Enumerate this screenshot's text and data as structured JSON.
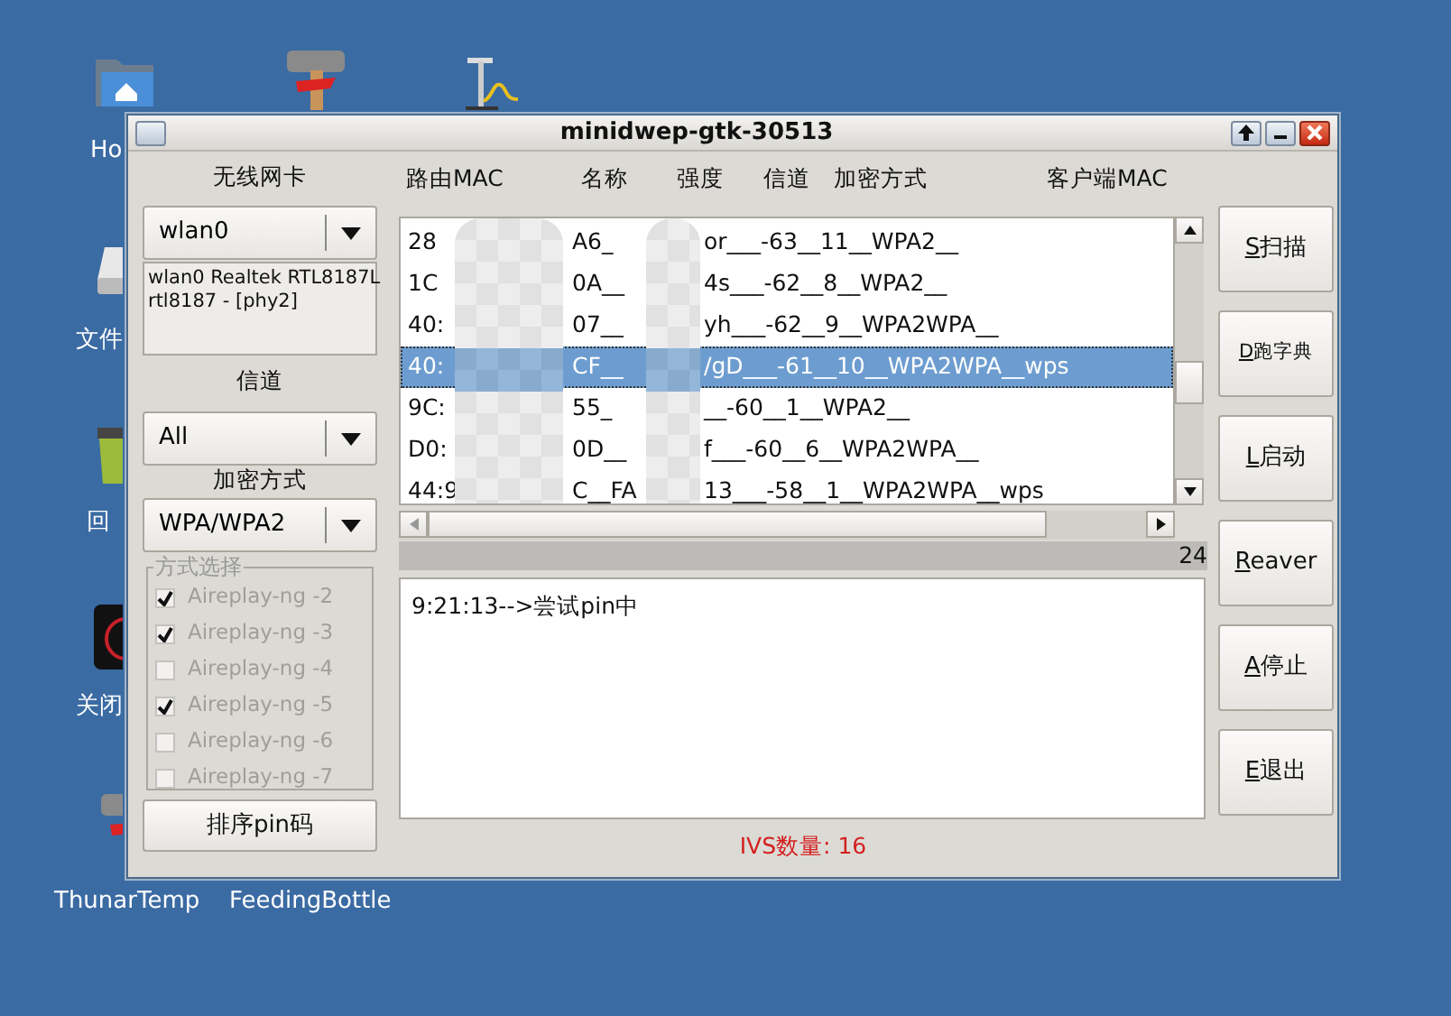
{
  "desktop": {
    "icons": [
      {
        "kind": "home",
        "label": "Ho"
      },
      {
        "kind": "tool"
      },
      {
        "kind": "pump"
      },
      {
        "kind": "drive",
        "label": "文件"
      },
      {
        "kind": "trash",
        "label": "回"
      },
      {
        "kind": "power",
        "label": "关闭"
      },
      {
        "kind": "tool",
        "label": "ThunarTemp"
      },
      {
        "kind": "hidden",
        "label": "FeedingBottle"
      }
    ]
  },
  "window": {
    "title": "minidwep-gtk-30513",
    "interface": {
      "label": "无线网卡",
      "value": "wlan0",
      "info": "wlan0 Realtek RTL8187L\nrtl8187 - [phy2]"
    },
    "channel": {
      "label": "信道",
      "value": "All"
    },
    "encryption": {
      "label": "加密方式",
      "value": "WPA/WPA2"
    },
    "methods": {
      "title": "方式选择",
      "items": [
        {
          "label": "Aireplay-ng -2",
          "checked": true,
          "disabled": true
        },
        {
          "label": "Aireplay-ng -3",
          "checked": true,
          "disabled": true
        },
        {
          "label": "Aireplay-ng -4",
          "checked": false,
          "disabled": true
        },
        {
          "label": "Aireplay-ng -5",
          "checked": true,
          "disabled": true
        },
        {
          "label": "Aireplay-ng -6",
          "checked": false,
          "disabled": true
        },
        {
          "label": "Aireplay-ng -7",
          "checked": false,
          "disabled": true
        }
      ]
    },
    "sort_button": "排序pin码",
    "networks": {
      "columns": [
        "路由MAC",
        "名称",
        "强度",
        "信道",
        "加密方式",
        "客户端MAC"
      ],
      "rows": [
        {
          "parts": [
            "28",
            "A6_",
            "or___-63__11__WPA2__"
          ],
          "selected": false
        },
        {
          "parts": [
            "1C",
            "0A__",
            "4s___-62__8__WPA2__"
          ],
          "selected": false
        },
        {
          "parts": [
            "40:",
            "07__",
            "yh___-62__9__WPA2WPA__"
          ],
          "selected": false
        },
        {
          "parts": [
            "40:",
            "CF__",
            "/gD___-61__10__WPA2WPA__wps"
          ],
          "selected": true
        },
        {
          "parts": [
            "9C:",
            "55_",
            "__-60__1__WPA2__"
          ],
          "selected": false
        },
        {
          "parts": [
            "D0:",
            "0D__",
            "f___-60__6__WPA2WPA__"
          ],
          "selected": false
        },
        {
          "parts": [
            "44:9",
            "C__FA",
            "13___-58__1__WPA2WPA__wps"
          ],
          "selected": false
        }
      ]
    },
    "count": "24",
    "log": [
      "9:21:13-->尝试pin中"
    ],
    "status": "IVS数量: 16",
    "buttons": [
      {
        "label": "S扫描",
        "kind": "normal"
      },
      {
        "label": "D跑字典",
        "kind": "small"
      },
      {
        "label": "L启动",
        "kind": "normal"
      },
      {
        "label": "Reaver",
        "kind": "normal"
      },
      {
        "label": "A停止",
        "kind": "normal"
      },
      {
        "label": "E退出",
        "kind": "normal"
      }
    ]
  }
}
